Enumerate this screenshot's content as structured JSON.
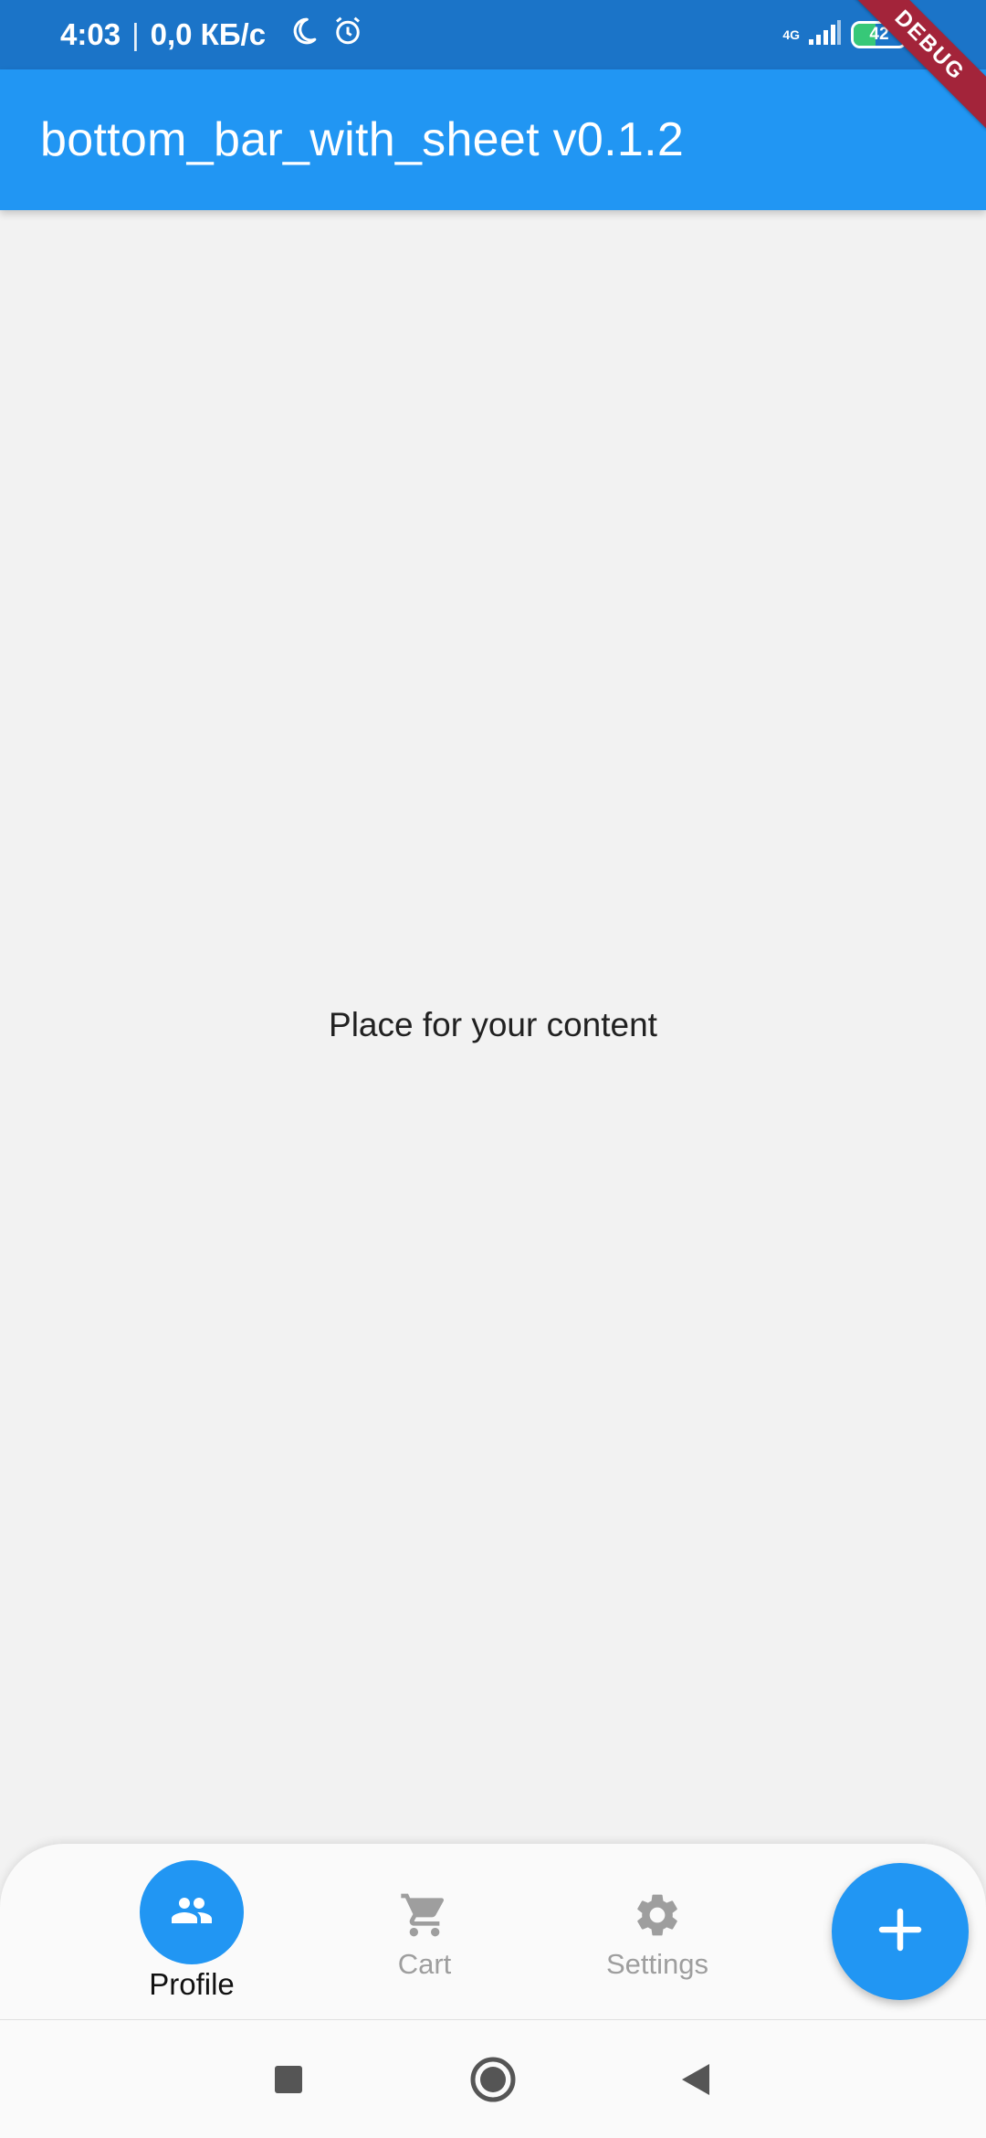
{
  "status_bar": {
    "time": "4:03",
    "separator": "|",
    "speed": "0,0 КБ/с",
    "network": "4G",
    "battery_level": "42",
    "icons": [
      "moon-icon",
      "alarm-icon",
      "signal-icon",
      "battery-icon",
      "charging-icon"
    ]
  },
  "app_bar": {
    "title": "bottom_bar_with_sheet v0.1.2",
    "color": "#2196f3"
  },
  "debug_banner": "DEBUG",
  "main": {
    "content_text": "Place for your content"
  },
  "bottom_bar": {
    "items": [
      {
        "label": "Profile",
        "icon": "people-icon",
        "active": true
      },
      {
        "label": "Cart",
        "icon": "cart-icon",
        "active": false
      },
      {
        "label": "Settings",
        "icon": "gear-icon",
        "active": false
      }
    ],
    "fab_icon": "plus-icon",
    "accent_color": "#2196f3",
    "inactive_color": "#9e9e9e"
  },
  "system_nav": {
    "icons": [
      "recents-icon",
      "home-icon",
      "back-icon"
    ]
  }
}
